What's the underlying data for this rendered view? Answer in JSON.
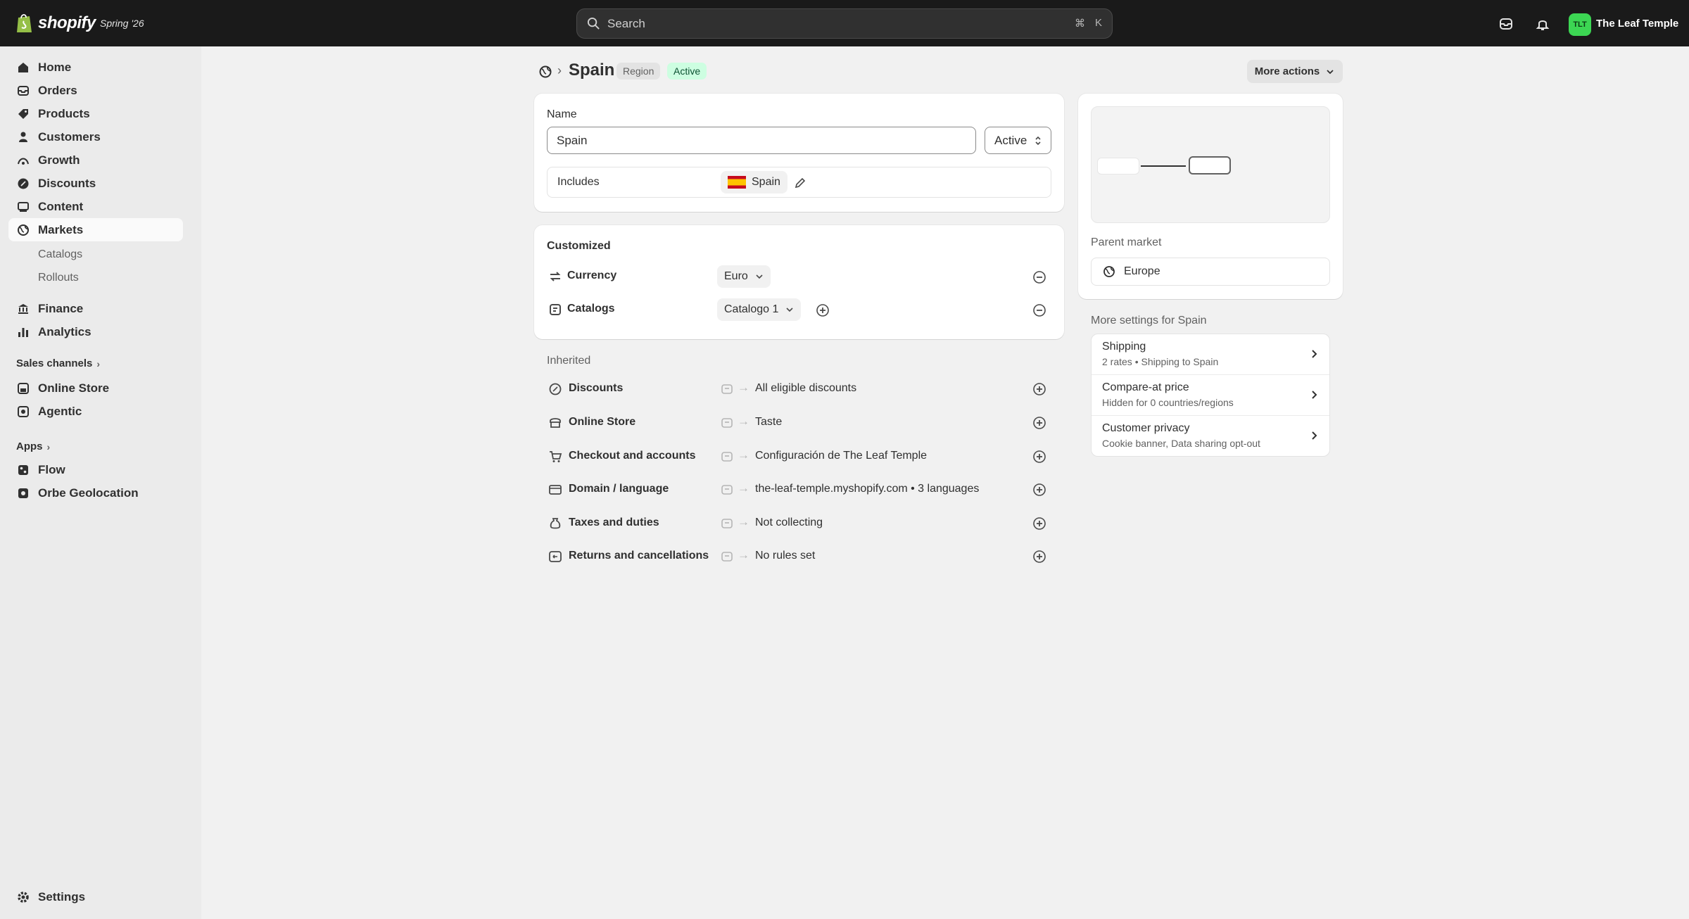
{
  "topbar": {
    "brand": "shopify",
    "edition": "Spring '26",
    "search_placeholder": "Search",
    "search_key_1": "⌘",
    "search_key_2": "K",
    "store_initials": "TLT",
    "store_name": "The Leaf Temple",
    "avatar_color": "#3cd653"
  },
  "sidebar": {
    "items": [
      {
        "label": "Home",
        "icon": "home-icon"
      },
      {
        "label": "Orders",
        "icon": "inbox-icon"
      },
      {
        "label": "Products",
        "icon": "tag-icon"
      },
      {
        "label": "Customers",
        "icon": "person-icon"
      },
      {
        "label": "Growth",
        "icon": "growth-icon"
      },
      {
        "label": "Discounts",
        "icon": "discount-icon"
      },
      {
        "label": "Content",
        "icon": "content-icon"
      },
      {
        "label": "Markets",
        "icon": "globe-icon"
      }
    ],
    "sub_items": [
      "Catalogs",
      "Rollouts"
    ],
    "items2": [
      {
        "label": "Finance",
        "icon": "bank-icon"
      },
      {
        "label": "Analytics",
        "icon": "bar-chart-icon"
      }
    ],
    "sales_channels_label": "Sales channels",
    "channels": [
      {
        "label": "Online Store",
        "icon": "store-icon"
      },
      {
        "label": "Agentic",
        "icon": "agent-icon"
      }
    ],
    "apps_label": "Apps",
    "apps": [
      {
        "label": "Flow",
        "icon": "flow-icon"
      },
      {
        "label": "Orbe Geolocation",
        "icon": "app-icon"
      }
    ],
    "settings_label": "Settings"
  },
  "header": {
    "title": "Spain",
    "badge_region": "Region",
    "badge_status": "Active",
    "more_actions": "More actions"
  },
  "name_card": {
    "name_label": "Name",
    "name_value": "Spain",
    "status_value": "Active",
    "includes_label": "Includes",
    "includes_country": "Spain"
  },
  "customized": {
    "title": "Customized",
    "rows": [
      {
        "label": "Currency",
        "value": "Euro"
      },
      {
        "label": "Catalogs",
        "value": "Catalogo 1"
      }
    ]
  },
  "inherited": {
    "title": "Inherited",
    "rows": [
      {
        "label": "Discounts",
        "value": "All eligible discounts"
      },
      {
        "label": "Online Store",
        "value": "Taste"
      },
      {
        "label": "Checkout and accounts",
        "value": "Configuración de The Leaf Temple"
      },
      {
        "label": "Domain / language",
        "value": "the-leaf-temple.myshopify.com • 3 languages"
      },
      {
        "label": "Taxes and duties",
        "value": "Not collecting"
      },
      {
        "label": "Returns and cancellations",
        "value": "No rules set"
      }
    ]
  },
  "parent": {
    "label": "Parent market",
    "value": "Europe"
  },
  "more_settings": {
    "title": "More settings for Spain",
    "items": [
      {
        "title": "Shipping",
        "subtitle": "2 rates • Shipping to Spain"
      },
      {
        "title": "Compare-at price",
        "subtitle": "Hidden for 0 countries/regions"
      },
      {
        "title": "Customer privacy",
        "subtitle": "Cookie banner, Data sharing opt-out"
      }
    ]
  }
}
